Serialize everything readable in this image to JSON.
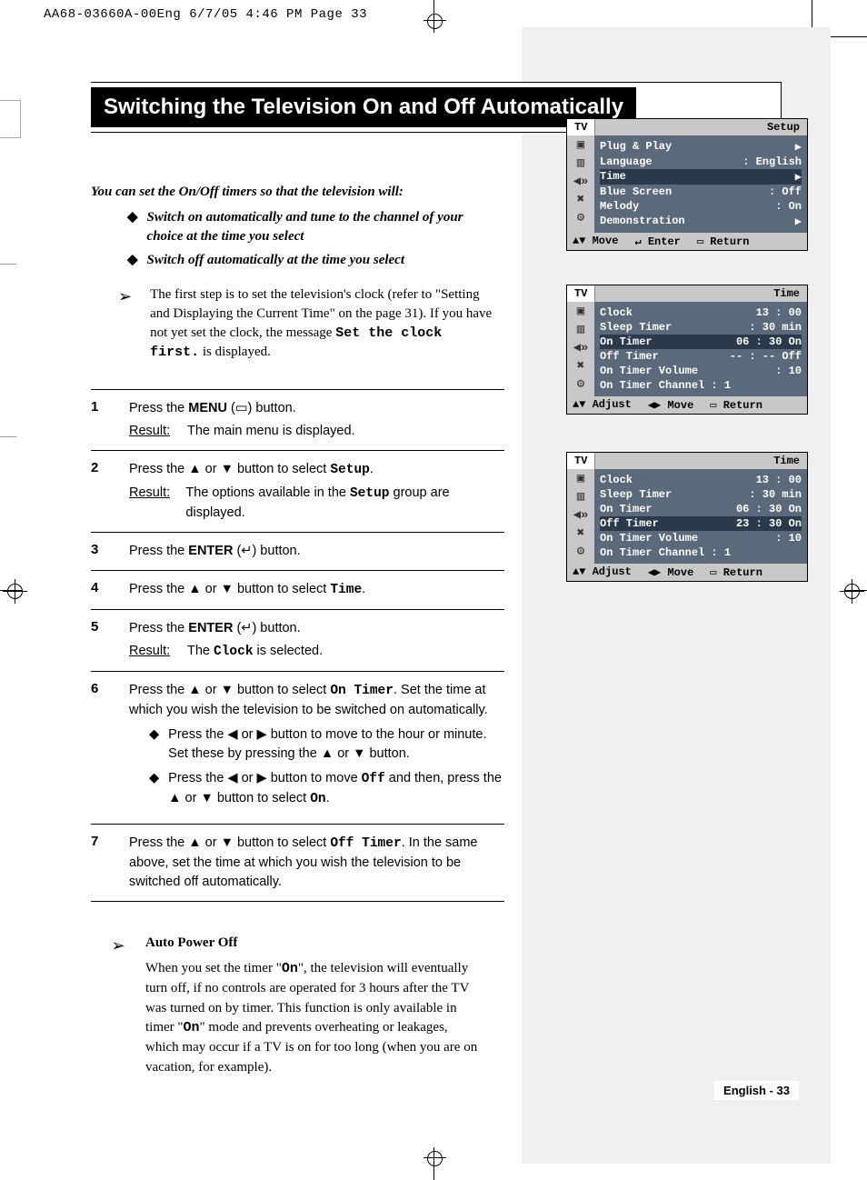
{
  "print_header": "AA68-03660A-00Eng  6/7/05  4:46 PM  Page 33",
  "title": "Switching the Television On and Off Automatically",
  "intro": "You can set the On/Off timers so that the television will:",
  "bullets": [
    "Switch on automatically and tune to the channel of your choice at the time you select",
    "Switch off automatically at the time you select"
  ],
  "note_pre": "The first step is to set the television's clock (refer to \"Setting and Displaying the Current Time\" on the page 31). If you have not yet set the clock, the message ",
  "note_mono": "Set the clock first.",
  "note_post": " is displayed.",
  "steps": [
    {
      "n": "1",
      "body_pre": "Press the ",
      "body_bold1": "MENU",
      "body_mid1": " (",
      "body_icon1": "▭",
      "body_post1": ") button.",
      "result": "The main menu is displayed."
    },
    {
      "n": "2",
      "body_pre": "Press the ▲ or ▼ button to select ",
      "body_mono": "Setup",
      "body_post": ".",
      "result_pre": "The options available in the ",
      "result_mono": "Setup",
      "result_post": " group are displayed."
    },
    {
      "n": "3",
      "body_pre": "Press the ",
      "body_bold1": "ENTER",
      "body_mid1": " (",
      "body_icon1": "↵",
      "body_post1": ") button."
    },
    {
      "n": "4",
      "body_pre": "Press the ▲ or ▼ button to select ",
      "body_mono": "Time",
      "body_post": "."
    },
    {
      "n": "5",
      "body_pre": "Press the ",
      "body_bold1": "ENTER",
      "body_mid1": " (",
      "body_icon1": "↵",
      "body_post1": ") button.",
      "result_pre": "The ",
      "result_mono": "Clock",
      "result_post": " is selected."
    },
    {
      "n": "6",
      "body_pre": "Press the ▲ or ▼ button to select ",
      "body_mono": "On Timer",
      "body_post": ". Set the time at which you wish the television to be switched on automatically.",
      "subs": [
        "Press the ◀ or ▶ button to move to the hour or minute. Set these by pressing the ▲ or ▼ button.",
        {
          "pre": "Press the ◀ or ▶ button to move ",
          "mono1": "Off",
          "mid": " and then, press the ▲ or ▼ button to select ",
          "mono2": "On",
          "post": "."
        }
      ]
    },
    {
      "n": "7",
      "body_pre": "Press the ▲ or ▼ button to select ",
      "body_mono": "Off Timer",
      "body_post": ". In the same above, set the time at which you wish the television to be switched off automatically."
    }
  ],
  "auto": {
    "title": "Auto Power Off",
    "pre": "When you set the timer \"",
    "mono1": "On",
    "mid1": "\", the television will eventually turn off, if no controls are operated for 3 hours after the TV was turned on by timer. This function is only available in timer \"",
    "mono2": "On",
    "post": "\" mode and prevents overheating or leakages, which may occur if a TV is on for too long (when you are on vacation, for example)."
  },
  "osd1": {
    "tab": "TV",
    "title": "Setup",
    "rows": [
      {
        "l": "Plug & Play",
        "r": "▶"
      },
      {
        "l": "Language",
        "r": ": English"
      },
      {
        "l": "Time",
        "r": "▶",
        "sel": true
      },
      {
        "l": "Blue Screen",
        "r": ": Off"
      },
      {
        "l": "Melody",
        "r": ": On"
      },
      {
        "l": "Demonstration",
        "r": "▶"
      }
    ],
    "foot": [
      "▲▼ Move",
      "↵ Enter",
      "▭ Return"
    ]
  },
  "osd2": {
    "tab": "TV",
    "title": "Time",
    "rows": [
      {
        "l": "Clock",
        "r": "13 : 00"
      },
      {
        "l": "Sleep Timer",
        "r": ": 30 min"
      },
      {
        "l": "On Timer",
        "r": "06 : 30 On",
        "sel": true
      },
      {
        "l": "Off Timer",
        "r": "-- : -- Off"
      },
      {
        "l": "On Timer Volume",
        "r": ": 10"
      },
      {
        "l": "On Timer Channel : 1",
        "r": ""
      }
    ],
    "foot": [
      "▲▼ Adjust",
      "◀▶ Move",
      "▭ Return"
    ]
  },
  "osd3": {
    "tab": "TV",
    "title": "Time",
    "rows": [
      {
        "l": "Clock",
        "r": "13 : 00"
      },
      {
        "l": "Sleep Timer",
        "r": ": 30 min"
      },
      {
        "l": "On Timer",
        "r": "06 : 30 On"
      },
      {
        "l": "Off Timer",
        "r": "23 : 30 On",
        "sel": true
      },
      {
        "l": "On Timer Volume",
        "r": ": 10"
      },
      {
        "l": "On Timer Channel : 1",
        "r": ""
      }
    ],
    "foot": [
      "▲▼ Adjust",
      "◀▶ Move",
      "▭ Return"
    ]
  },
  "icons": [
    "▣",
    "▥",
    "◀»",
    "✖",
    "⚙"
  ],
  "footer": "English - 33"
}
